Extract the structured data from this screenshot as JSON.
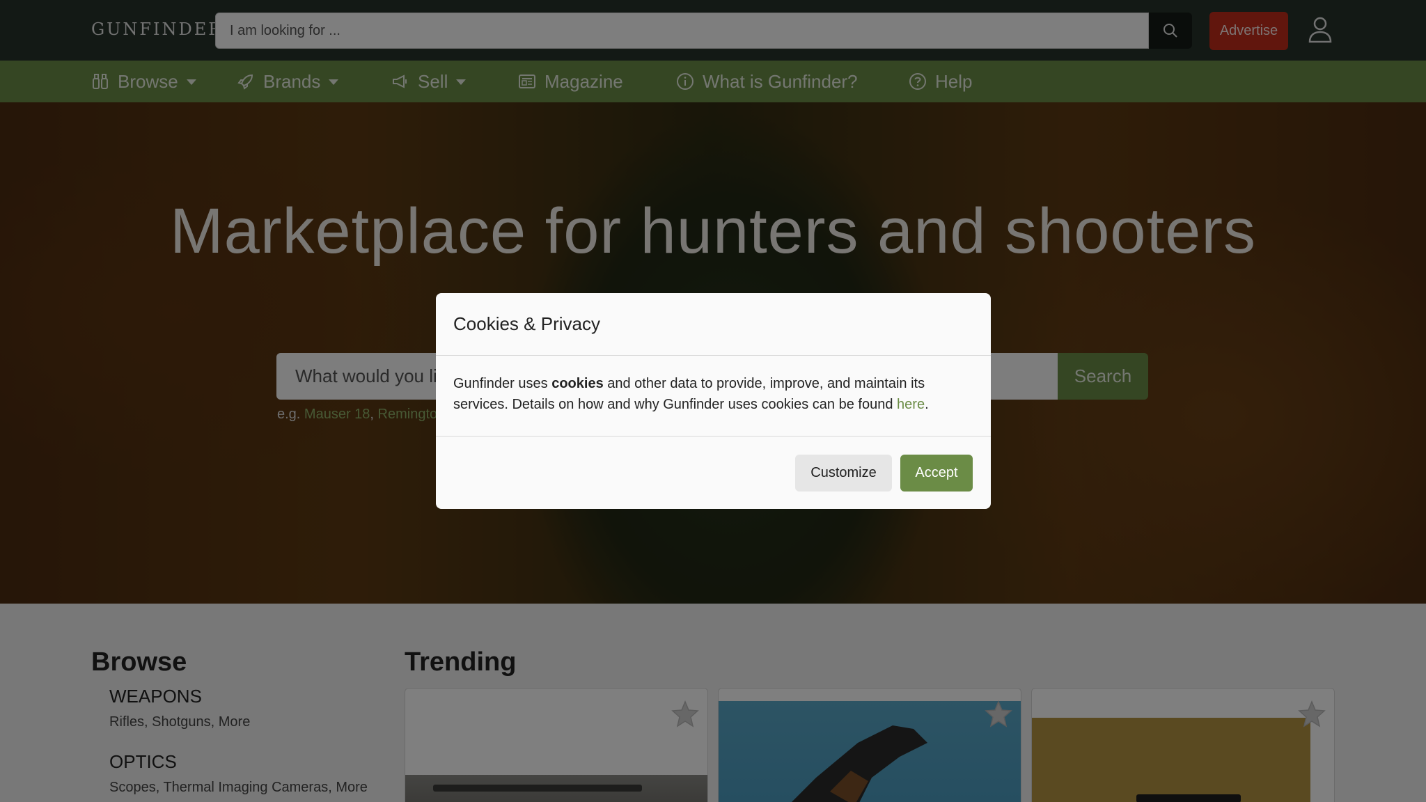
{
  "header": {
    "logo_text": "GUNFINDER",
    "search_placeholder": "I am looking for ...",
    "advertise_label": "Advertise"
  },
  "nav": {
    "items": [
      {
        "label": "Browse",
        "icon": "binoculars-icon",
        "dropdown": true
      },
      {
        "label": "Brands",
        "icon": "rocket-icon",
        "dropdown": true
      },
      {
        "label": "Sell",
        "icon": "megaphone-icon",
        "dropdown": true
      },
      {
        "label": "Magazine",
        "icon": "newspaper-icon",
        "dropdown": false
      },
      {
        "label": "What is Gunfinder?",
        "icon": "info-circle-icon",
        "dropdown": false
      },
      {
        "label": "Help",
        "icon": "question-circle-icon",
        "dropdown": false
      }
    ]
  },
  "hero": {
    "title": "Marketplace for hunters and shooters",
    "search_placeholder": "What would you like to find?",
    "search_button": "Search",
    "examples_prefix": "e.g. ",
    "example_1": "Mauser 18",
    "example_sep": ", ",
    "example_2": "Remington"
  },
  "browse": {
    "title": "Browse",
    "categories": [
      {
        "name": "WEAPONS",
        "links": "Rifles, Shotguns, More"
      },
      {
        "name": "OPTICS",
        "links": "Scopes, Thermal Imaging Cameras, More"
      }
    ]
  },
  "trending": {
    "title": "Trending"
  },
  "cookie_modal": {
    "title": "Cookies & Privacy",
    "body_before": "Gunfinder uses ",
    "body_bold": "cookies",
    "body_after": " and other data to provide, improve, and maintain its services. Details on how and why Gunfinder uses cookies can be found ",
    "link": "here",
    "period": ".",
    "customize_label": "Customize",
    "accept_label": "Accept"
  },
  "colors": {
    "topbar": "#26322a",
    "nav": "#6b8c46",
    "accent_green": "#6b8c46",
    "advertise_red": "#c22d1b"
  }
}
